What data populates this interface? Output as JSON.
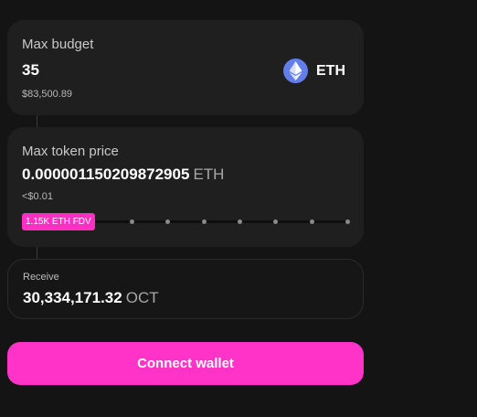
{
  "budget": {
    "label": "Max budget",
    "amount": "35",
    "fiat": "$83,500.89",
    "token_icon": "ethereum-icon",
    "token": "ETH"
  },
  "price": {
    "label": "Max token price",
    "amount": "0.000001150209872905",
    "unit": "ETH",
    "fiat": "<$0.01",
    "slider": {
      "thumb_label": "1.15K ETH FDV",
      "level": 0,
      "stops": 7
    }
  },
  "receive": {
    "label": "Receive",
    "amount": "30,334,171.32",
    "unit": "OCT"
  },
  "actions": {
    "connect_label": "Connect wallet"
  },
  "colors": {
    "accent": "#ff33c7",
    "card": "#1f1f1f",
    "background": "#141414",
    "eth": "#627eea"
  }
}
